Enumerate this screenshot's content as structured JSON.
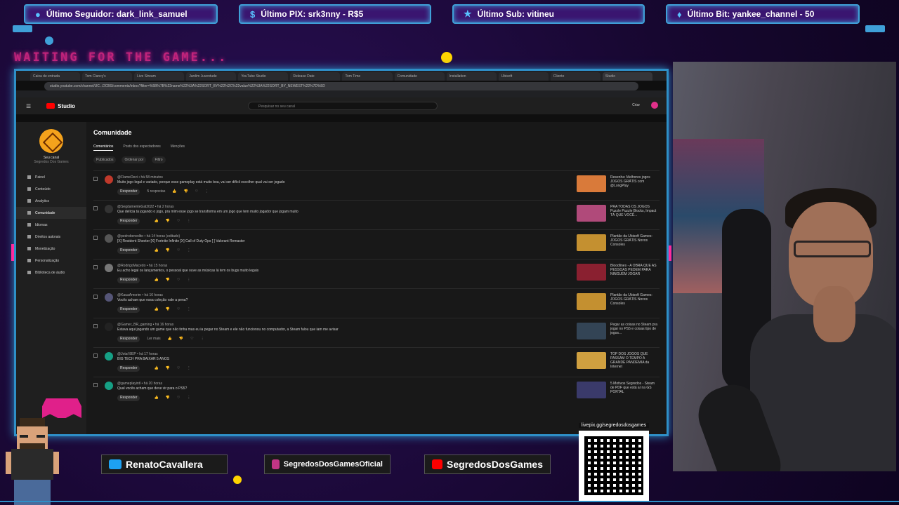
{
  "overlay": {
    "alerts": [
      {
        "label": "Último Seguidor: dark_link_samuel",
        "icon": "user-icon"
      },
      {
        "label": "Último PIX: srk3nny - R$5",
        "icon": "dollar-icon"
      },
      {
        "label": "Último Sub: vitineu",
        "icon": "star-icon"
      },
      {
        "label": "Último Bit: yankee_channel - 50",
        "icon": "diamond-icon"
      }
    ],
    "waiting_text": "WAITING FOR THE GAME...",
    "socials": [
      {
        "label": "RenatoCavallera",
        "icon": "twitter-icon",
        "color": "#1da1f2"
      },
      {
        "label": "SegredosDosGamesOficial",
        "icon": "instagram-icon",
        "color": "#c13584"
      },
      {
        "label": "SegredosDosGames",
        "icon": "youtube-icon",
        "color": "#ff0000"
      }
    ],
    "qr_label": "livepix.gg/segredosdosgames",
    "accent": "#3fa0d8",
    "pink": "#ff2a9c"
  },
  "browser": {
    "tabs": [
      "Caixa de entrada",
      "Tom Clancy's",
      "Live Stream",
      "Jardim Juventude",
      "YouTube Studio",
      "Release Date",
      "Tom Time",
      "Comunidade",
      "Installation",
      "Ubisoft",
      "Cliente",
      "Studio"
    ],
    "address": "studio.youtube.com/channel/UC...DCBS/comments/inbox?filter=%5B%7B%22name%22%3A%22SORT_BY%22%2C%22value%22%3A%22SORT_BY_NEWEST%22%7D%5D"
  },
  "studio": {
    "logo": "Studio",
    "search_placeholder": "Pesquisar no seu canal",
    "create_label": "Criar",
    "channel_name": "Seu canal",
    "channel_sub": "Segredos Dos Games",
    "nav": [
      "Painel",
      "Conteúdo",
      "Analytics",
      "Comunidade",
      "Idiomas",
      "Direitos autorais",
      "Monetização",
      "Personalização",
      "Biblioteca de áudio"
    ],
    "active_nav": 3,
    "page_title": "Comunidade",
    "subtabs": [
      "Comentários",
      "Posts dos espectadores",
      "Menções"
    ],
    "filters": [
      "Publicados",
      "Ordenar por",
      "Filtro"
    ],
    "reply_label": "Responder",
    "comments": [
      {
        "author": "@FlameDevi • há 58 minutos",
        "text": "Muito jogo legal e variado, porque esse gameplay está muito boa, vai ser difícil escolher qual vai ser jogado",
        "avatar_color": "#c0392b",
        "thumb_color": "#d97a3a",
        "video": "Resenha: Melhores jogos JOGOS GRÁTIS com @LongPlay",
        "likes": "5 respostas"
      },
      {
        "author": "@SegdamenteGal2022 • há 2 horas",
        "text": "Que delícia tá jogando o jogo, pra mim esse jogo se transforma em um jogo que tem muito jogador que jogam muito",
        "avatar_color": "#333",
        "thumb_color": "#b04a7a",
        "video": "PRA TODAS OS JOGOS Puzzle Puzzle Blocks, Impact TÁ QUE VOCÊ...",
        "likes": ""
      },
      {
        "author": "@pedrobenedito • há 14 horas (editado)",
        "text": "[X] Resident Shooter [X] Fortnite Infinite [X] Call of Duty Ops [ ] Valorant Remaster",
        "avatar_color": "#555",
        "thumb_color": "#c49030",
        "video": "Plantão da Ubisoft Games: JOGOS GRÁTIS Novos Consoles",
        "likes": ""
      },
      {
        "author": "@RodrigoMacedo • há 15 horas",
        "text": "Eu acho legal os lançamentos, o pessoal que ouve as músicas lá tem os bugs muito legais",
        "avatar_color": "#777",
        "thumb_color": "#8a2030",
        "video": "Bloodlines - A OBRA QUE AS PESSOAS PEDEM PARA NINGUÉM JOGAR",
        "likes": ""
      },
      {
        "author": "@KauaAmorim • há 16 horas",
        "text": "Vocês acham que essa coleção vale a pena?",
        "avatar_color": "#557",
        "thumb_color": "#c49030",
        "video": "Plantão da Ubisoft Games: JOGOS GRÁTIS Novos Consoles",
        "likes": ""
      },
      {
        "author": "@Gamer_BR_gaming • há 16 horas",
        "text": "Estava aqui jogando um game que não tinha mas eu ia pegar no Steam e ele não funcionou no computador, a Steam falou que iam me avisar",
        "avatar_color": "#222",
        "thumb_color": "#334455",
        "video": "Pegar as coisas no Steam pra jogar no PS5 e coisas tipo de jogos...",
        "likes": "Ler mais"
      },
      {
        "author": "@Jotaf 8EP • há 17 horas",
        "text": "BIG TECH PRA BAIXAR 5 ANOS",
        "avatar_color": "#16a085",
        "thumb_color": "#d0a040",
        "video": "TOP DOS JOGOS QUE PASSAM O TEMPO A GRANDE PANDEMIA da Internet",
        "likes": ""
      },
      {
        "author": "@gameplayintl • há 20 horas",
        "text": "Qual vocês acham que deve vir para o PS5?",
        "avatar_color": "#16a085",
        "thumb_color": "#3a3a6a",
        "video": "5 Motivos Segredos - Steam de PDF que está aí na GS PORTAL",
        "likes": ""
      }
    ]
  }
}
